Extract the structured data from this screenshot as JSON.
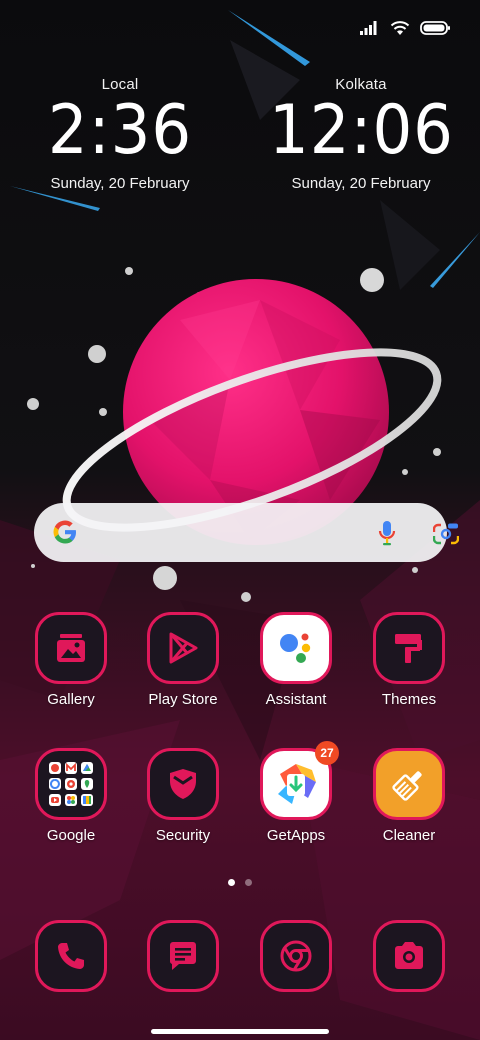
{
  "status_bar": {
    "signal_icon": "signal-bars-icon",
    "wifi_icon": "wifi-icon",
    "battery_icon": "battery-icon"
  },
  "clocks": [
    {
      "city": "Local",
      "time": "2:36",
      "date": "Sunday, 20 February"
    },
    {
      "city": "Kolkata",
      "time": "12:06",
      "date": "Sunday, 20 February"
    }
  ],
  "search": {
    "logo": "google-g-icon",
    "mic_icon": "microphone-icon",
    "lens_icon": "google-lens-icon"
  },
  "apps": [
    {
      "label": "Gallery",
      "icon": "gallery-icon"
    },
    {
      "label": "Play Store",
      "icon": "play-store-icon"
    },
    {
      "label": "Assistant",
      "icon": "assistant-icon"
    },
    {
      "label": "Themes",
      "icon": "themes-icon"
    },
    {
      "label": "Google",
      "icon": "google-folder-icon"
    },
    {
      "label": "Security",
      "icon": "security-icon"
    },
    {
      "label": "GetApps",
      "icon": "getapps-icon",
      "badge": "27"
    },
    {
      "label": "Cleaner",
      "icon": "cleaner-icon"
    }
  ],
  "dock": [
    {
      "icon": "phone-icon"
    },
    {
      "icon": "messages-icon"
    },
    {
      "icon": "chrome-icon"
    },
    {
      "icon": "camera-icon"
    }
  ],
  "page_indicator": {
    "pages": 2,
    "current": 1
  },
  "colors": {
    "accent": "#e0185a",
    "tile_bg": "#1c1520",
    "planet": "#e8196c",
    "badge": "#f04a23"
  }
}
